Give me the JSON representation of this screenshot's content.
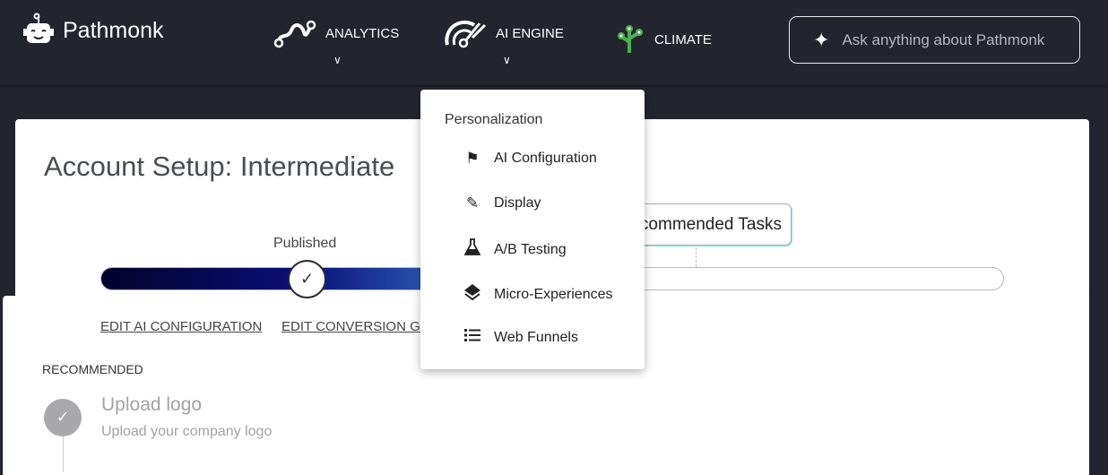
{
  "header": {
    "brand": "Pathmonk",
    "nav": [
      {
        "label": "ANALYTICS",
        "icon": "analytics-path-icon"
      },
      {
        "label": "AI ENGINE",
        "icon": "ai-engine-icon"
      },
      {
        "label": "CLIMATE",
        "icon": "climate-tree-icon",
        "color": "#4caf50"
      }
    ],
    "ask_placeholder": "Ask anything about Pathmonk"
  },
  "main": {
    "title": "Account Setup:  Intermediate",
    "progress_label": "Published",
    "recommended_button": "Recommended Tasks",
    "links": [
      "EDIT AI CONFIGURATION",
      "EDIT CONVERSION GO"
    ],
    "section": "RECOMMENDED",
    "task": {
      "title": "Upload logo",
      "subtitle": "Upload your company logo",
      "completed": true
    }
  },
  "dropdown": {
    "heading": "Personalization",
    "items": [
      {
        "label": "AI Configuration",
        "icon": "flag-icon"
      },
      {
        "label": "Display",
        "icon": "pencil-icon"
      },
      {
        "label": "A/B Testing",
        "icon": "flask-icon"
      },
      {
        "label": "Micro-Experiences",
        "icon": "layers-icon"
      },
      {
        "label": "Web Funnels",
        "icon": "list-icon"
      }
    ]
  }
}
